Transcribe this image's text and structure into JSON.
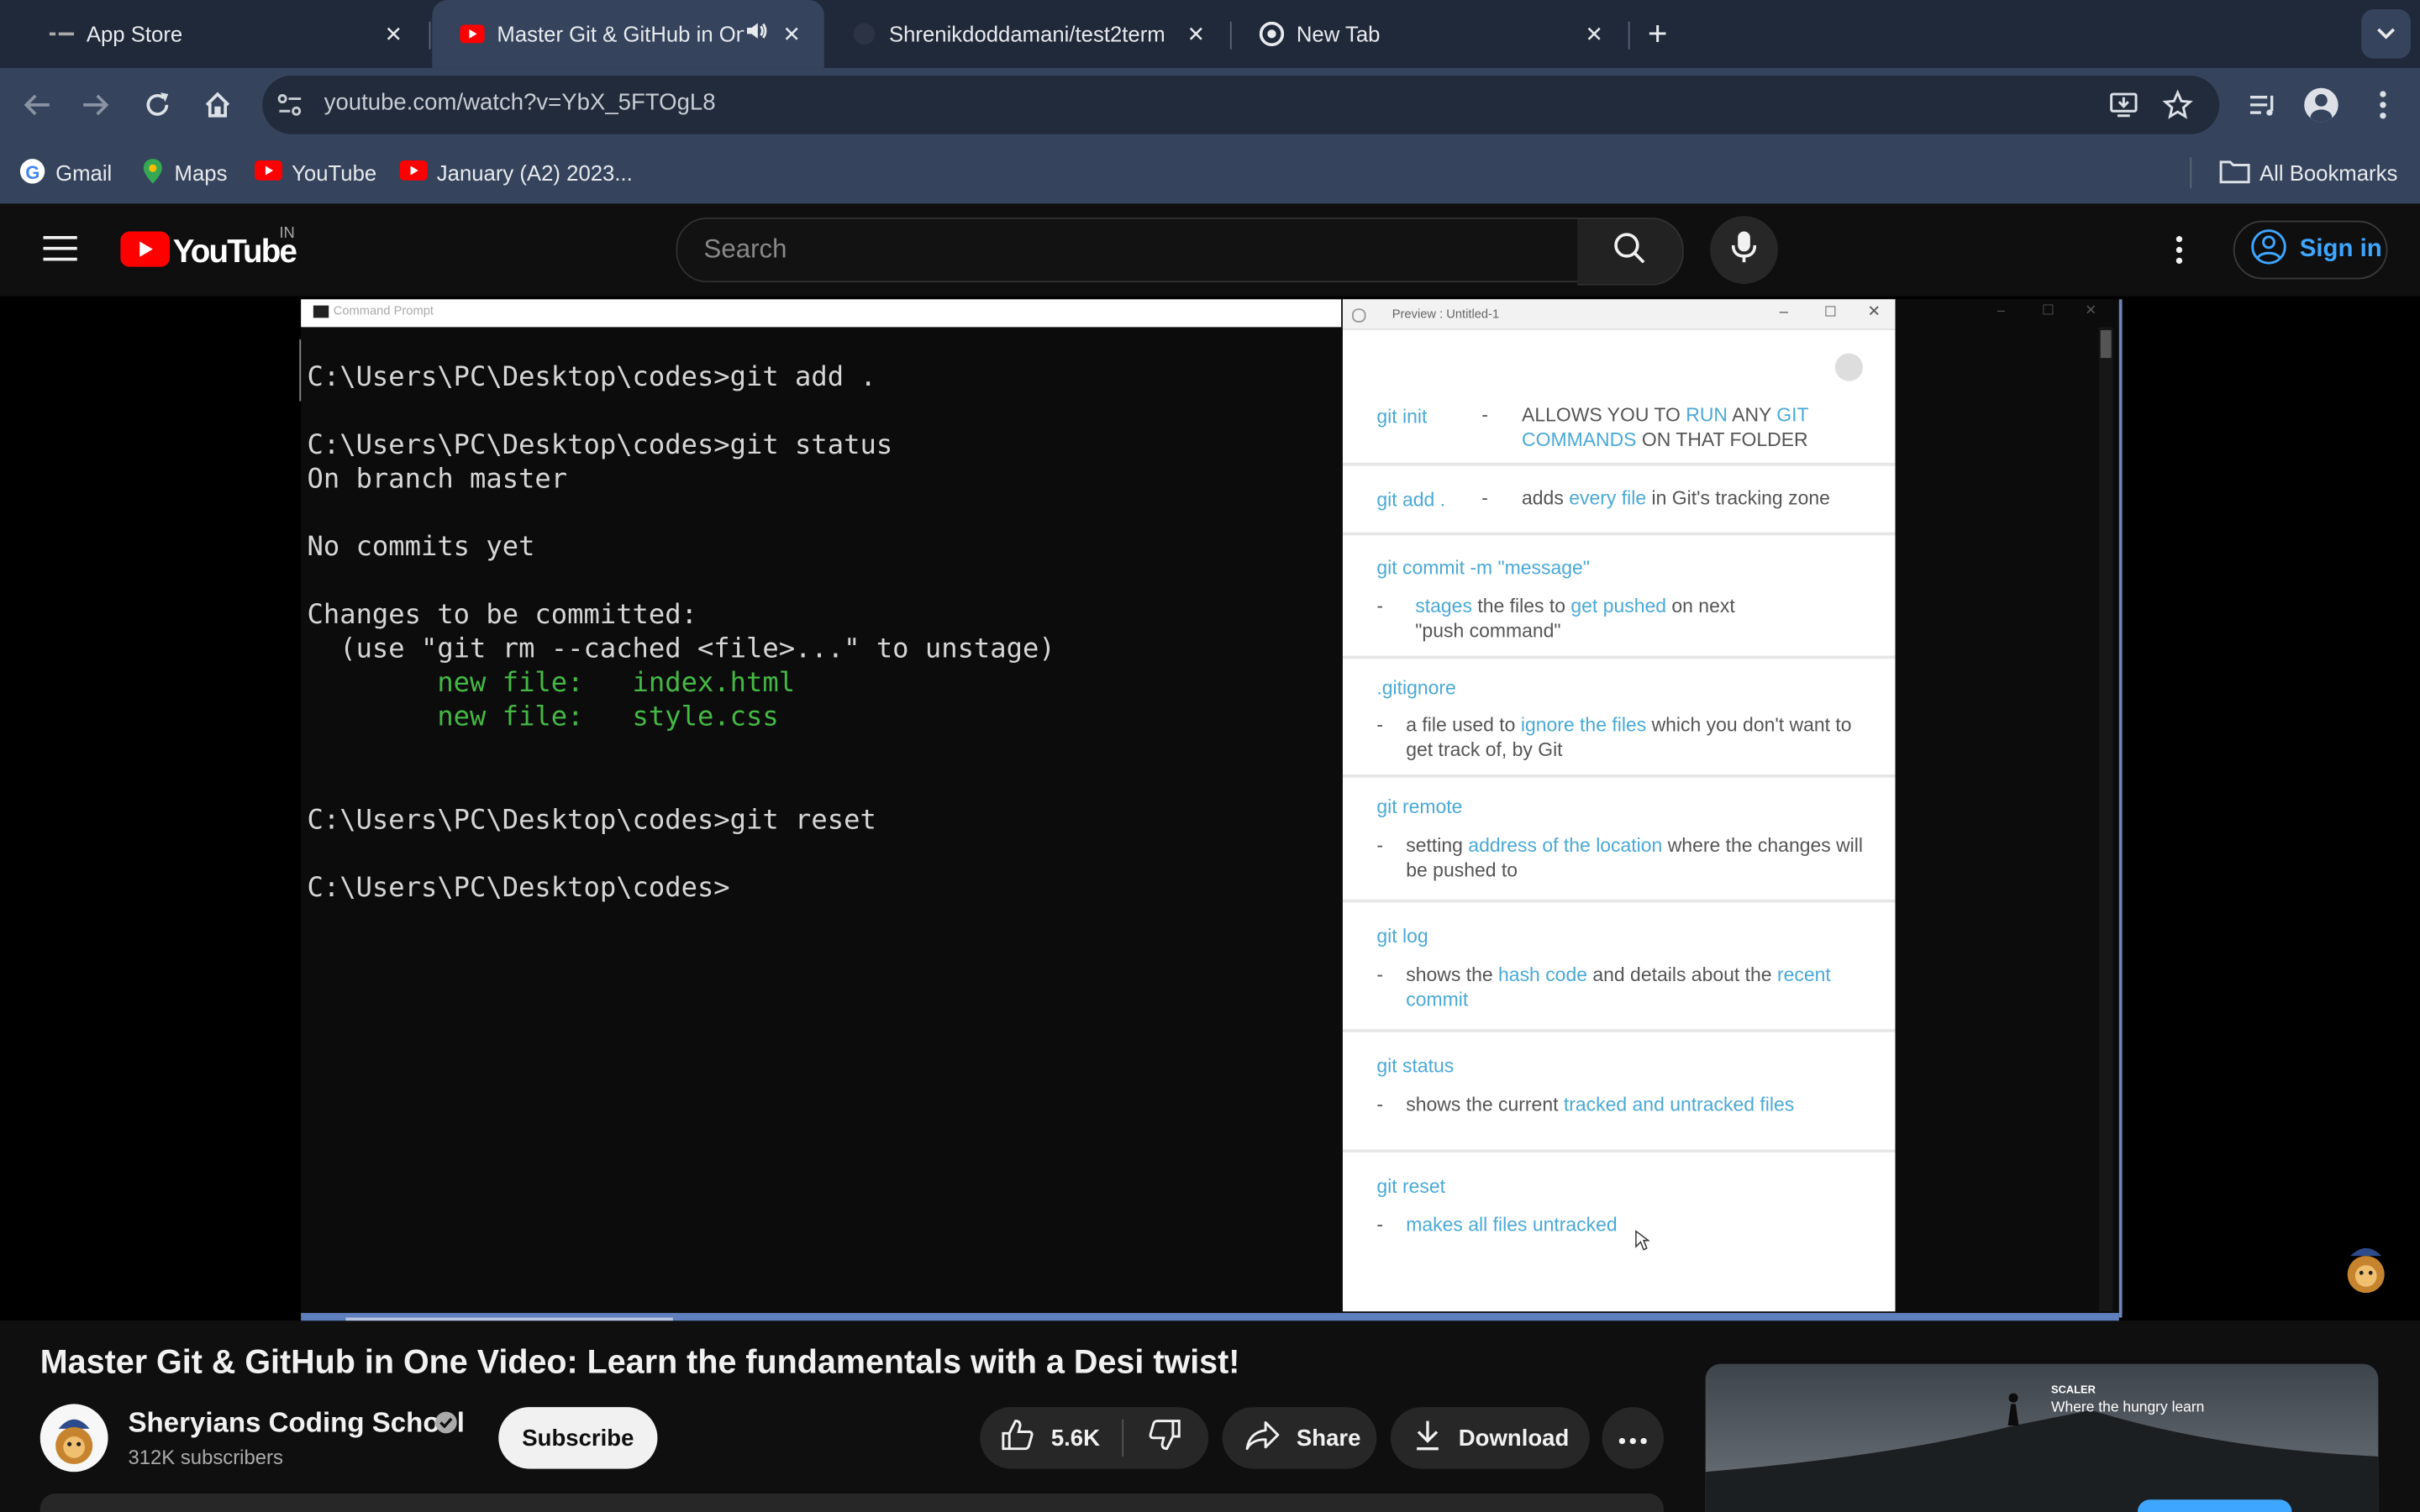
{
  "browser": {
    "tabs": [
      {
        "title": "App Store"
      },
      {
        "title": "Master Git & GitHub in On"
      },
      {
        "title": "Shrenikdoddamani/test2term"
      },
      {
        "title": "New Tab"
      }
    ],
    "url": "youtube.com/watch?v=YbX_5FTOgL8",
    "bookmarks": [
      "Gmail",
      "Maps",
      "YouTube",
      "January (A2) 2023..."
    ],
    "all_bookmarks": "All Bookmarks"
  },
  "youtube": {
    "logo_text": "YouTube",
    "region": "IN",
    "search_placeholder": "Search",
    "sign_in": "Sign in"
  },
  "video": {
    "cmd_title": "Command Prompt",
    "preview_title": "Preview : Untitled-1",
    "terminal_lines": [
      "C:\\Users\\PC\\Desktop\\codes>git add .",
      "C:\\Users\\PC\\Desktop\\codes>git status",
      "On branch master",
      "No commits yet",
      "Changes to be committed:",
      "  (use \"git rm --cached <file>...\" to unstage)",
      "        new file:   index.html",
      "        new file:   style.css",
      "C:\\Users\\PC\\Desktop\\codes>git reset",
      "C:\\Users\\PC\\Desktop\\codes>"
    ],
    "git_notes": [
      {
        "cmd": "git init",
        "dash": "-",
        "desc_parts": [
          "ALLOWS YOU TO ",
          "RUN",
          " ANY ",
          "GIT",
          " ",
          "COMMANDS",
          " ON THAT FOLDER"
        ]
      },
      {
        "cmd": "git add .",
        "dash": "-",
        "desc_parts": [
          "adds ",
          "every file",
          " in Git's tracking zone"
        ]
      },
      {
        "cmd": "git commit -m \"message\"",
        "dash": "-",
        "desc_parts": [
          "stages",
          " the files to ",
          "get pushed",
          " on next \"push command\""
        ]
      },
      {
        "cmd": ".gitignore",
        "dash": "-",
        "desc_parts": [
          "a file used to ",
          "ignore the files",
          " which you don't want to get track of, by Git"
        ]
      },
      {
        "cmd": "git remote",
        "dash": "-",
        "desc_parts": [
          "setting ",
          "address of the location",
          " where the changes will be pushed to"
        ]
      },
      {
        "cmd": "git log",
        "dash": "-",
        "desc_parts": [
          "shows the ",
          "hash code",
          " and details about the ",
          "recent commit"
        ]
      },
      {
        "cmd": "git status",
        "dash": "-",
        "desc_parts": [
          "shows the current ",
          "tracked and untracked files"
        ]
      },
      {
        "cmd": "git reset",
        "dash": "-",
        "desc_parts": [
          "makes all files untracked"
        ]
      }
    ]
  },
  "meta": {
    "title": "Master Git & GitHub in One Video: Learn the fundamentals with a Desi twist!",
    "channel": "Sheryians Coding School",
    "subscribers": "312K subscribers",
    "subscribe": "Subscribe",
    "likes": "5.6K",
    "share": "Share",
    "download": "Download"
  },
  "ad": {
    "brand": "SCALER",
    "tagline": "Where the hungry learn"
  },
  "colors": {
    "accent_blue": "#3ea6ff",
    "youtube_red": "#ff0000",
    "git_cyan": "#4aa9d6",
    "terminal_green": "#44b844"
  }
}
